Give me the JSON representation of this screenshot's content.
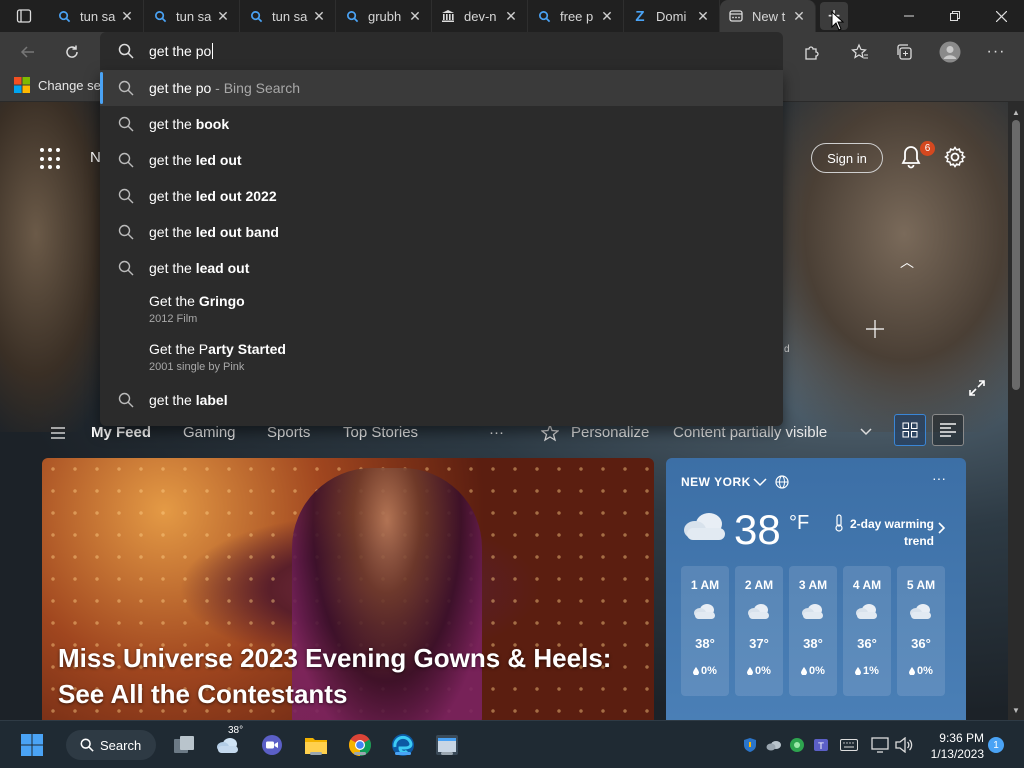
{
  "tabs": [
    {
      "label": "tun sa",
      "icon": "search-icon"
    },
    {
      "label": "tun sa",
      "icon": "search-icon"
    },
    {
      "label": "tun sa",
      "icon": "search-icon"
    },
    {
      "label": "grubh",
      "icon": "search-icon"
    },
    {
      "label": "dev-n",
      "icon": "bank-icon"
    },
    {
      "label": "free p",
      "icon": "search-icon"
    },
    {
      "label": "Domi",
      "icon": "z-logo-icon",
      "icon_glyph": "Z"
    },
    {
      "label": "New t",
      "icon": "newtab-page-icon",
      "active": true
    }
  ],
  "new_tab_glyph": "+",
  "omnibox": {
    "query": "get the po"
  },
  "favorites": {
    "item": "Change sec"
  },
  "suggestions": [
    {
      "prefix": "get the po",
      "suffix": " - Bing Search",
      "icon": "search-icon",
      "highlight": true
    },
    {
      "prefix": "get the ",
      "bold": "book",
      "icon": "search-icon"
    },
    {
      "prefix": "get the ",
      "bold": "led out",
      "icon": "search-icon"
    },
    {
      "prefix": "get the ",
      "bold": "led out 2022",
      "icon": "search-icon"
    },
    {
      "prefix": "get the ",
      "bold": "led out band",
      "icon": "search-icon"
    },
    {
      "prefix": "get the ",
      "bold": "lead out",
      "icon": "search-icon"
    },
    {
      "prefix": "Get the ",
      "bold": "Gringo",
      "sub": "2012 Film",
      "icon": "none"
    },
    {
      "prefix": "Get the P",
      "bold": "arty Started",
      "sub": "2001 single by Pink",
      "icon": "none"
    },
    {
      "prefix": "get the ",
      "bold": "label",
      "icon": "search-icon"
    }
  ],
  "page_header": {
    "brand_initial": "N",
    "signin_label": "Sign in",
    "notification_count": "6",
    "overlay_fragment": "d"
  },
  "feed_nav": {
    "items": [
      "My Feed",
      "Gaming",
      "Sports",
      "Top Stories"
    ],
    "more": "···",
    "personalize": "Personalize",
    "content_visibility": "Content partially visible"
  },
  "hero": {
    "title": "Miss Universe 2023 Evening Gowns & Heels: See All the Contestants"
  },
  "weather": {
    "city": "NEW YORK",
    "temp": "38",
    "unit": "°F",
    "trend": "2-day warming trend",
    "more": "···",
    "hourly": [
      {
        "time": "1 AM",
        "temp": "38°",
        "precip": "0%"
      },
      {
        "time": "2 AM",
        "temp": "37°",
        "precip": "0%"
      },
      {
        "time": "3 AM",
        "temp": "38°",
        "precip": "0%"
      },
      {
        "time": "4 AM",
        "temp": "36°",
        "precip": "1%"
      },
      {
        "time": "5 AM",
        "temp": "36°",
        "precip": "0%"
      }
    ]
  },
  "taskbar": {
    "search_label": "Search",
    "weather_temp": "38°",
    "time": "9:36 PM",
    "date": "1/13/2023",
    "notification_count": "1"
  },
  "colors": {
    "accent": "#4aa3f5",
    "badge": "#d4481f",
    "weather_bg": "#3c6fa6"
  }
}
